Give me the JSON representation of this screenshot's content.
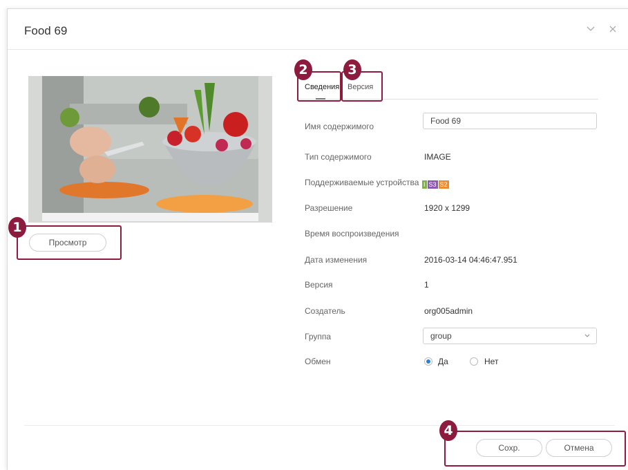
{
  "dialog": {
    "title": "Food 69",
    "minimize_icon": "chevron-down-icon",
    "close_icon": "close-icon"
  },
  "preview_button": "Просмотр",
  "tabs": [
    {
      "label": "Сведения",
      "active": true
    },
    {
      "label": "Версия",
      "active": false
    }
  ],
  "details": {
    "content_name": {
      "label": "Имя содержимого",
      "value": "Food 69"
    },
    "content_type": {
      "label": "Тип содержимого",
      "value": "IMAGE"
    },
    "devices": {
      "label": "Поддерживаемые устройства",
      "badges": [
        {
          "text": "I",
          "color": "#7cb342"
        },
        {
          "text": "S3",
          "color": "#8e58b5"
        },
        {
          "text": "S2",
          "color": "#ef8a2e"
        }
      ]
    },
    "resolution": {
      "label": "Разрешение",
      "value": "1920 x 1299"
    },
    "play_time": {
      "label": "Время воспроизведения",
      "value": ""
    },
    "modified": {
      "label": "Дата изменения",
      "value": "2016-03-14 04:46:47.951"
    },
    "version": {
      "label": "Версия",
      "value": "1"
    },
    "creator": {
      "label": "Создатель",
      "value": "org005admin"
    },
    "group": {
      "label": "Группа",
      "value": "group"
    },
    "share": {
      "label": "Обмен",
      "options": [
        {
          "label": "Да",
          "selected": true
        },
        {
          "label": "Нет",
          "selected": false
        }
      ]
    }
  },
  "footer": {
    "save": "Сохр.",
    "cancel": "Отмена"
  },
  "callouts": [
    "1",
    "2",
    "3",
    "4"
  ],
  "colors": {
    "callout": "#8c1b3e",
    "radio_selected": "#2f7fd6"
  }
}
